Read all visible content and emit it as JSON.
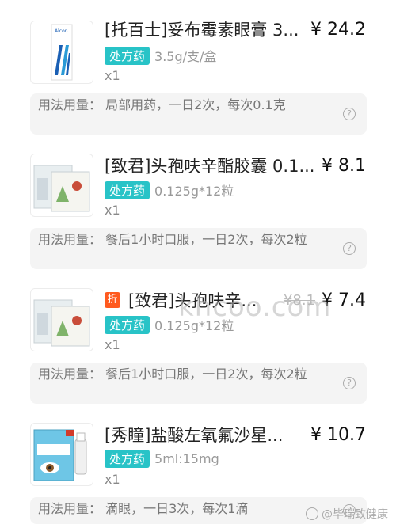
{
  "items": [
    {
      "title": "[托百士]妥布霉素眼膏 3...",
      "price": "¥ 24.2",
      "rx_label": "处方药",
      "spec": "3.5g/支/盒",
      "qty": "x1",
      "usage": "用法用量：  局部用药，一日2次，每次0.1克",
      "thumb_text": "Alcon"
    },
    {
      "title": "[致君]头孢呋辛酯胶囊 0.1...",
      "price": "¥ 8.1",
      "rx_label": "处方药",
      "spec": "0.125g*12粒",
      "qty": "x1",
      "usage": "用法用量：  餐后1小时口服，一日2次，每次2粒"
    },
    {
      "discount": "折",
      "title": "[致君]头孢呋辛...",
      "old_price": "¥8.1",
      "price": "¥ 7.4",
      "rx_label": "处方药",
      "spec": "0.125g*12粒",
      "qty": "x1",
      "usage": "用法用量：  餐后1小时口服，一日2次，每次2粒"
    },
    {
      "title": "[秀瞳]盐酸左氧氟沙星...",
      "price": "¥ 10.7",
      "rx_label": "处方药",
      "spec": "5ml:15mg",
      "qty": "x1",
      "usage": "用法用量：  滴眼，一日3次，每次1滴"
    }
  ],
  "help_icon": "?",
  "watermark": "khcoo.com",
  "footer_watermark": "@毕瑞致健康"
}
